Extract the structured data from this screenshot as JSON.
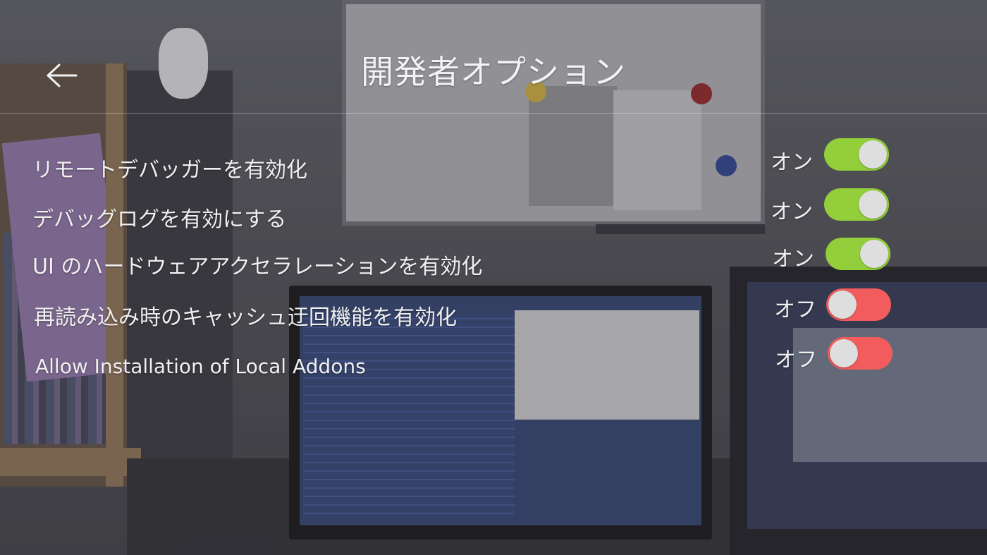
{
  "window": {
    "title": "開発者オプション"
  },
  "header": {
    "back_icon": "arrow-left-icon"
  },
  "options": [
    {
      "label": "リモートデバッガーを有効化",
      "state": "オン",
      "enabled": true
    },
    {
      "label": "デバッグログを有効にする",
      "state": "オン",
      "enabled": true
    },
    {
      "label": "UI のハードウェアアクセラレーションを有効化",
      "state": "オン",
      "enabled": true
    },
    {
      "label": "再読み込み時のキャッシュ迂回機能を有効化",
      "state": "オフ",
      "enabled": false
    },
    {
      "label": "Allow Installation of Local Addons",
      "state": "オフ",
      "enabled": false
    }
  ],
  "colors": {
    "toggle_on": "#93cf3a",
    "toggle_off": "#f25c5c",
    "text": "#f0f0f0"
  }
}
